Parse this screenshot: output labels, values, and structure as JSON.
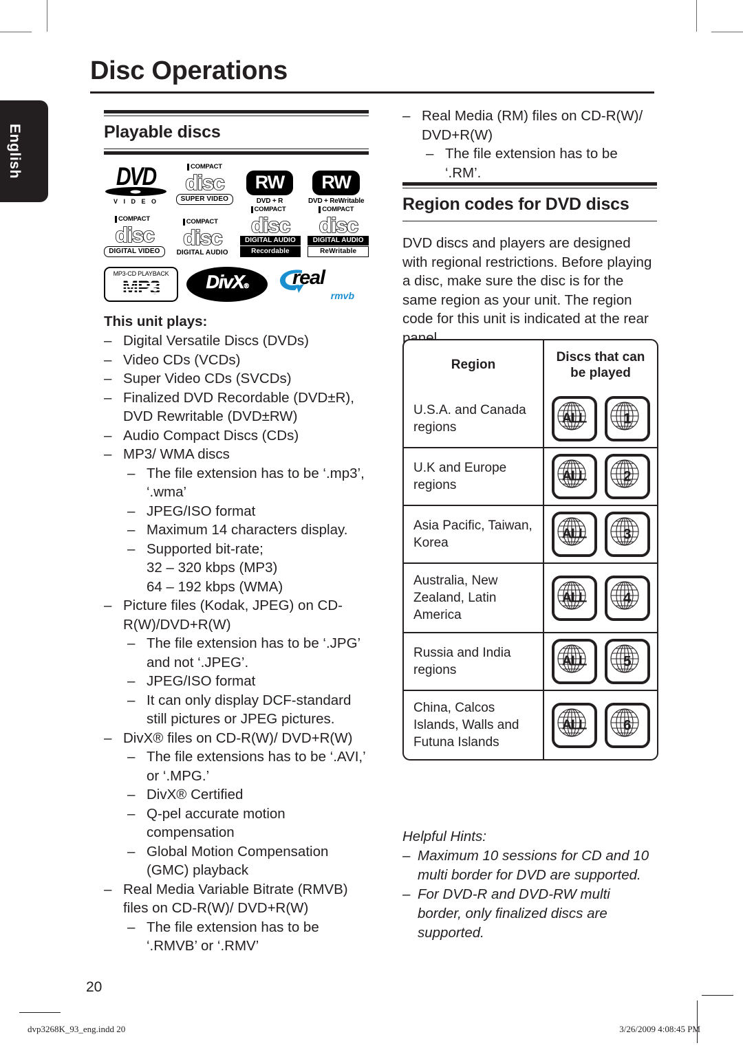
{
  "page": {
    "title": "Disc Operations",
    "language_tab": "English",
    "page_number": "20"
  },
  "footer": {
    "file": "dvp3268K_93_eng.indd   20",
    "timestamp": "3/26/2009   4:08:45 PM"
  },
  "left_column": {
    "heading": "Playable discs",
    "logos": [
      {
        "name": "dvd-video-logo",
        "word": "DVD",
        "sub": "V I D E O",
        "tm": "™"
      },
      {
        "name": "compact-disc-super-video-logo",
        "top": "COMPACT",
        "disc": "disc",
        "bottom": "SUPER  VIDEO"
      },
      {
        "name": "dvd-plus-r-logo",
        "badge": "RW",
        "sub": "DVD + R"
      },
      {
        "name": "dvd-plus-rewritable-logo",
        "badge": "RW",
        "sub": "DVD + ReWritable"
      },
      {
        "name": "compact-disc-digital-video-logo",
        "top": "COMPACT",
        "disc": "disc",
        "bottom": "DIGITAL VIDEO"
      },
      {
        "name": "compact-disc-digital-audio-logo",
        "top": "COMPACT",
        "disc": "disc",
        "bottom": "DIGITAL AUDIO"
      },
      {
        "name": "compact-disc-recordable-logo",
        "top": "COMPACT",
        "disc": "disc",
        "band": "DIGITAL AUDIO",
        "bottom": "Recordable"
      },
      {
        "name": "compact-disc-rewritable-logo",
        "top": "COMPACT",
        "disc": "disc",
        "band": "DIGITAL AUDIO",
        "bottom": "ReWritable"
      },
      {
        "name": "mp3-cd-playback-logo",
        "top": "MP3-CD PLAYBACK",
        "word": "MP3"
      },
      {
        "name": "divx-logo",
        "word": "DivX",
        "reg": "®"
      },
      {
        "name": "real-rmvb-logo",
        "word": "real",
        "sub": "rmvb",
        "color": "#1a8fd0"
      }
    ],
    "subhead": "This unit plays:",
    "items": [
      {
        "level": 1,
        "text": "Digital Versatile Discs (DVDs)"
      },
      {
        "level": 1,
        "text": "Video CDs (VCDs)"
      },
      {
        "level": 1,
        "text": "Super Video CDs (SVCDs)"
      },
      {
        "level": 1,
        "text": "Finalized DVD Recordable (DVD±R), DVD Rewritable (DVD±RW)"
      },
      {
        "level": 1,
        "text": "Audio Compact Discs (CDs)"
      },
      {
        "level": 1,
        "text": "MP3/ WMA discs"
      },
      {
        "level": 2,
        "text": "The file extension has to be ‘.mp3’, ‘.wma’"
      },
      {
        "level": 2,
        "text": "JPEG/ISO format"
      },
      {
        "level": 2,
        "text": "Maximum 14 characters display."
      },
      {
        "level": 2,
        "text": "Supported bit-rate;"
      },
      {
        "level": 0,
        "text": "32 – 320 kbps (MP3)"
      },
      {
        "level": 0,
        "text": "64 – 192 kbps (WMA)"
      },
      {
        "level": 1,
        "text": "Picture files (Kodak, JPEG) on CD-R(W)/DVD+R(W)"
      },
      {
        "level": 2,
        "text": "The file extension has to be ‘.JPG’ and not ‘.JPEG’."
      },
      {
        "level": 2,
        "text": "JPEG/ISO format"
      },
      {
        "level": 2,
        "text": "It can only display DCF-standard still pictures or JPEG pictures."
      },
      {
        "level": 1,
        "text": "DivX® files on CD-R(W)/ DVD+R(W)"
      },
      {
        "level": 2,
        "text": "The file extensions has to be ‘.AVI,’ or ‘.MPG.’"
      },
      {
        "level": 2,
        "text": "DivX® Certified"
      },
      {
        "level": 2,
        "text": "Q-pel accurate motion compensation"
      },
      {
        "level": 2,
        "text": "Global Motion Compensation (GMC) playback"
      },
      {
        "level": 1,
        "text": "Real Media Variable Bitrate (RMVB) files on CD-R(W)/ DVD+R(W)"
      },
      {
        "level": 2,
        "text": "The file extension has to be ‘.RMVB’ or ‘.RMV’"
      }
    ]
  },
  "right_column": {
    "top_items": [
      {
        "level": 1,
        "text": "Real Media (RM) files on CD-R(W)/ DVD+R(W)"
      },
      {
        "level": 2,
        "text": "The file extension has to be ‘.RM’."
      }
    ],
    "heading": "Region codes for DVD discs",
    "paragraph": "DVD discs and players are designed with regional restrictions. Before playing a disc, make sure the disc is for the same region as your unit. The region code for this unit is indicated at the rear panel.",
    "table": {
      "headers": [
        "Region",
        "Discs that can be played"
      ],
      "rows": [
        {
          "region": "U.S.A. and Canada regions",
          "icons": [
            "ALL",
            "1"
          ]
        },
        {
          "region": "U.K and Europe regions",
          "icons": [
            "ALL",
            "2"
          ]
        },
        {
          "region": "Asia Pacific, Taiwan, Korea",
          "icons": [
            "ALL",
            "3"
          ]
        },
        {
          "region": "Australia, New Zealand, Latin America",
          "icons": [
            "ALL",
            "4"
          ]
        },
        {
          "region": "Russia and India regions",
          "icons": [
            "ALL",
            "5"
          ]
        },
        {
          "region": "China, Calcos Islands, Walls and Futuna Islands",
          "icons": [
            "ALL",
            "6"
          ]
        }
      ]
    },
    "hints": {
      "title": "Helpful Hints:",
      "lines": [
        "Maximum 10 sessions for CD and 10 multi border for DVD are supported.",
        "For DVD-R and DVD-RW multi border, only finalized discs are supported."
      ]
    }
  }
}
